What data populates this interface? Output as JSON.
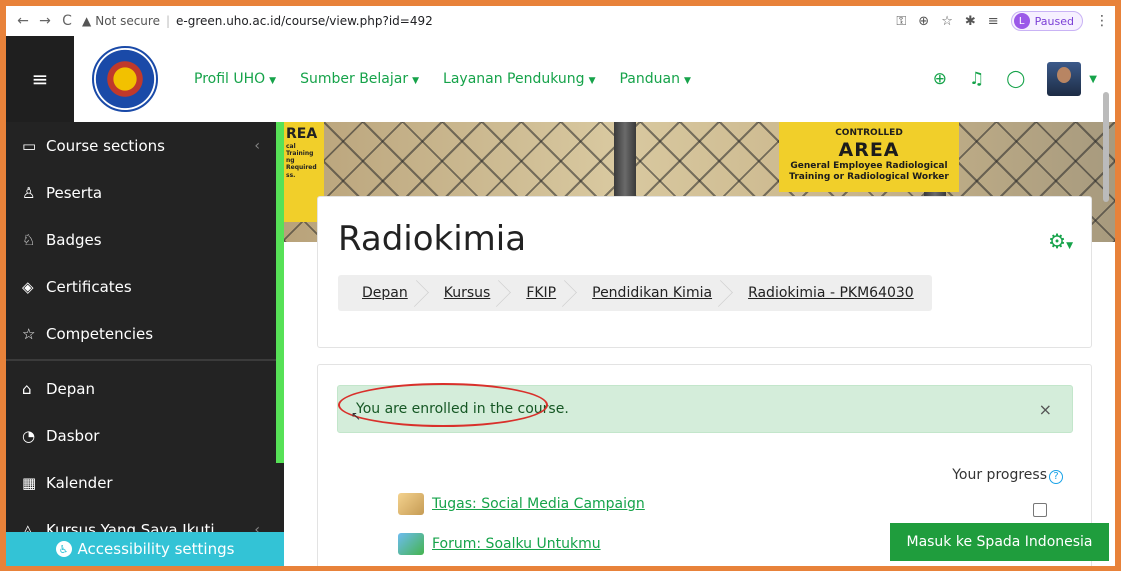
{
  "browser": {
    "back_icon": "←",
    "forward_icon": "→",
    "reload_icon": "C",
    "not_secure": "Not secure",
    "url": "e-green.uho.ac.id/course/view.php?id=492",
    "paused_label": "Paused",
    "profile_letter": "L"
  },
  "navbar": {
    "menu": [
      {
        "label": "Profil UHO"
      },
      {
        "label": "Sumber Belajar"
      },
      {
        "label": "Layanan Pendukung"
      },
      {
        "label": "Panduan"
      }
    ]
  },
  "sidebar": {
    "items": [
      {
        "label": "Course sections",
        "icon": "folder-icon"
      },
      {
        "label": "Peserta",
        "icon": "users-icon"
      },
      {
        "label": "Badges",
        "icon": "badge-icon"
      },
      {
        "label": "Certificates",
        "icon": "certificate-icon"
      },
      {
        "label": "Competencies",
        "icon": "star-icon"
      },
      {
        "label": "Depan",
        "icon": "home-icon"
      },
      {
        "label": "Dasbor",
        "icon": "dashboard-icon"
      },
      {
        "label": "Kalender",
        "icon": "calendar-icon"
      },
      {
        "label": "Kursus Yang Saya Ikuti",
        "icon": "graduation-cap-icon"
      }
    ],
    "accessibility": "Accessibility settings"
  },
  "hero": {
    "sign_left_big": "REA",
    "sign_left_small": "cal Training ng Required ss.",
    "sign_right_top": "CONTROLLED",
    "sign_right_big": "AREA",
    "sign_right_small": "General Employee Radiological Training or Radiological Worker"
  },
  "course": {
    "title": "Radiokimia",
    "breadcrumb": [
      "Depan",
      "Kursus",
      "FKIP",
      "Pendidikan Kimia",
      "Radiokimia - PKM64030"
    ]
  },
  "content": {
    "alert": "You are enrolled in the course.",
    "alert_close": "×",
    "progress_label": "Your progress",
    "activities": [
      {
        "label": "Tugas: Social Media Campaign",
        "icon": "assignment-icon"
      },
      {
        "label": "Forum: Soalku Untukmu",
        "icon": "forum-icon"
      }
    ],
    "spada_button": "Masuk ke Spada Indonesia"
  },
  "colors": {
    "accent_green": "#16a34a",
    "sidebar_bg": "#232323",
    "alert_bg": "#d4edda",
    "annotation_red": "#d9302b"
  }
}
